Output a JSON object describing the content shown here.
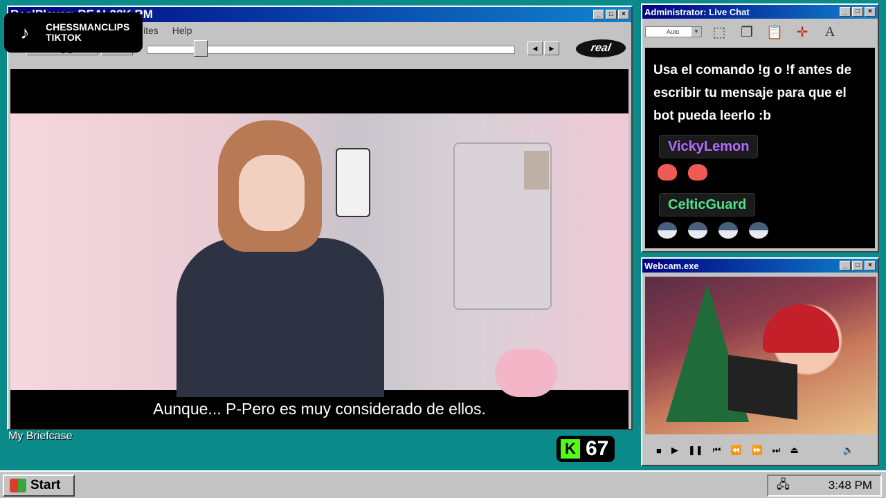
{
  "realplayer": {
    "title": "RealPlayer: REAL28K.RM",
    "menu": [
      "ites",
      "Help"
    ],
    "logo": "real",
    "subtitle": "Aunque... P-Pero es muy considerado de ellos."
  },
  "tiktok": {
    "line1": "CHESSMANCLIPS",
    "line2": "TIKTOK"
  },
  "chat": {
    "title": "Administrator: Live Chat",
    "font_select": "Auto",
    "message": "Usa el comando !g o !f antes de escribir tu mensaje para que el bot pueda leerlo :b",
    "users": [
      {
        "name": "VickyLemon",
        "color": "#b36bff"
      },
      {
        "name": "CelticGuard",
        "color": "#4de38a"
      }
    ]
  },
  "webcam": {
    "title": "Webcam.exe"
  },
  "desktop": {
    "briefcase": "My Briefcase",
    "kick_count": "67",
    "kick_letter": "K"
  },
  "taskbar": {
    "start": "Start",
    "time": "3:48 PM"
  },
  "colors": {
    "desktop": "#0b8a8a",
    "titlebar": "#000080",
    "kick": "#53fc18"
  }
}
